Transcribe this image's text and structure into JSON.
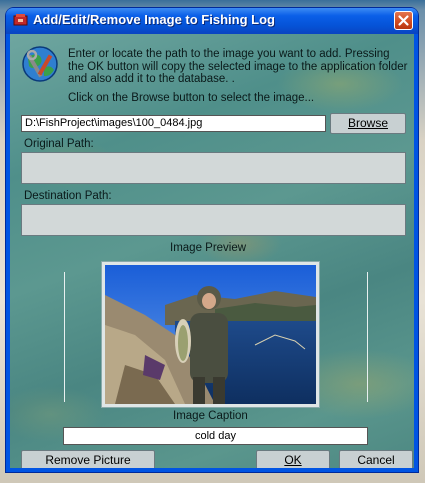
{
  "window": {
    "title": "Add/Edit/Remove Image to Fishing Log"
  },
  "instructions": {
    "line1": "Enter or locate the path to the image you want to add. Pressing the OK button will copy the selected image to the application folder and also add it to the database.  .",
    "line2": "Click on the Browse button to select the image..."
  },
  "path": {
    "value": "D:\\FishProject\\images\\100_0484.jpg"
  },
  "buttons": {
    "browse": "Browse",
    "remove": "Remove Picture",
    "ok": "OK",
    "cancel": "Cancel"
  },
  "fields": {
    "original_label": "Original Path:",
    "original_value": "",
    "destination_label": "Destination Path:",
    "destination_value": ""
  },
  "preview": {
    "label": "Image Preview"
  },
  "caption": {
    "label": "Image Caption",
    "value": "cold day"
  },
  "icons": {
    "title": "fishing-log-app-icon",
    "close": "close-icon",
    "logo": "globe-tools-icon"
  },
  "colors": {
    "titlebar": "#0a5fe8",
    "close": "#d04a1f",
    "button_face": "#c8d0d2"
  }
}
